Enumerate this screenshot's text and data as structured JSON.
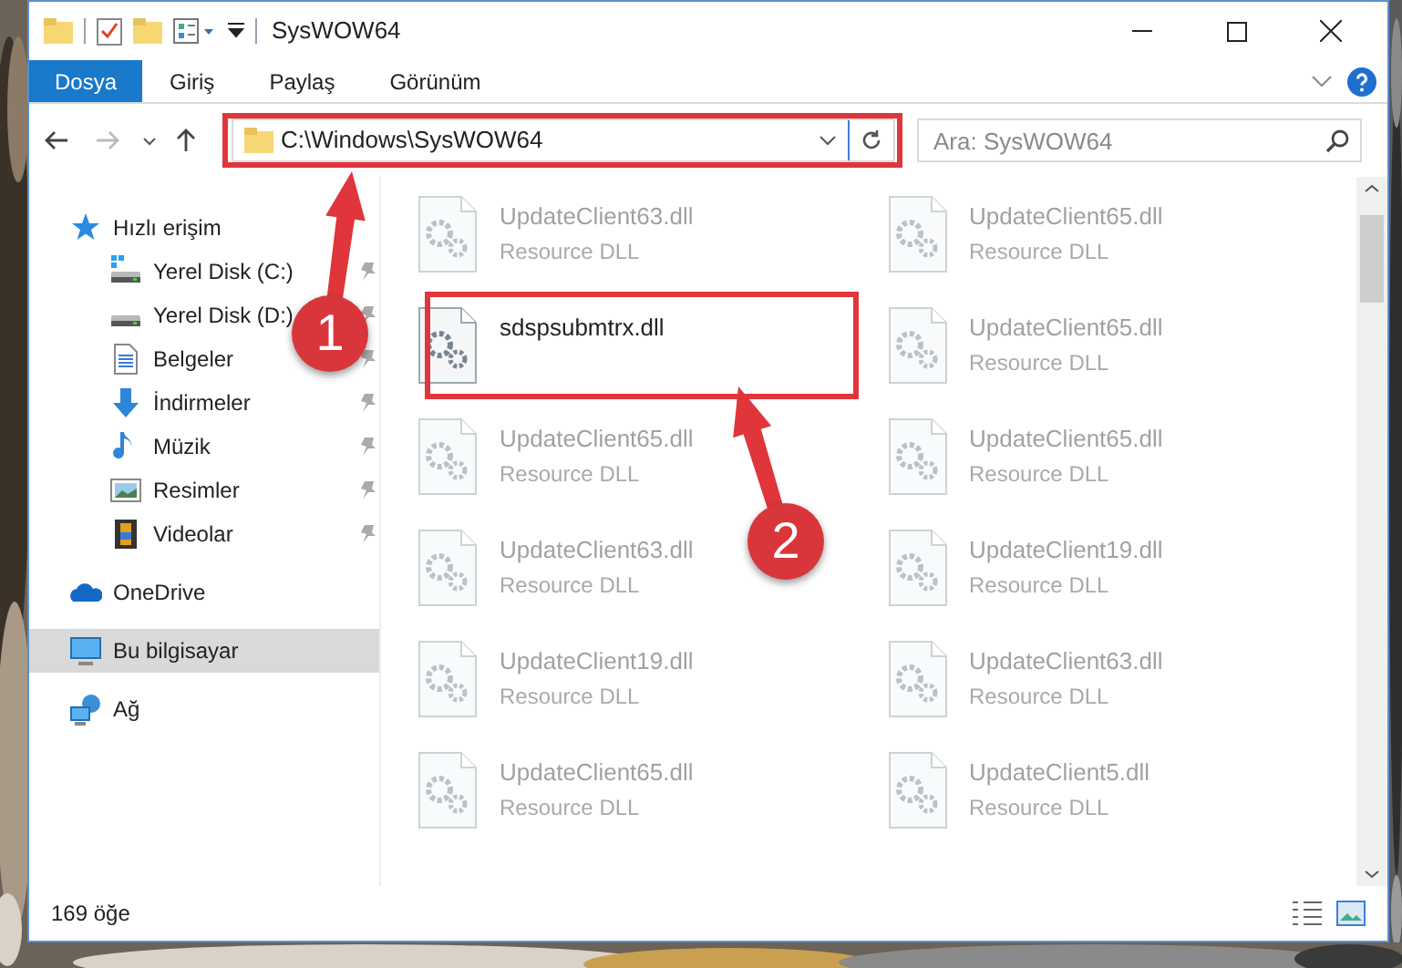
{
  "window": {
    "title": "SysWOW64"
  },
  "ribbon_tabs": [
    {
      "label": "Dosya",
      "selected": true
    },
    {
      "label": "Giriş",
      "selected": false
    },
    {
      "label": "Paylaş",
      "selected": false
    },
    {
      "label": "Görünüm",
      "selected": false
    }
  ],
  "address_bar": {
    "path": "C:\\Windows\\SysWOW64"
  },
  "search": {
    "placeholder": "Ara: SysWOW64"
  },
  "sidebar": {
    "items": [
      {
        "kind": "star",
        "label": "Hızlı erişim",
        "selected": false,
        "children": [
          {
            "kind": "disk-c",
            "label": "Yerel Disk (C:)",
            "pinned": true,
            "selected": false
          },
          {
            "kind": "disk",
            "label": "Yerel Disk (D:)",
            "pinned": true,
            "selected": false
          },
          {
            "kind": "document",
            "label": "Belgeler",
            "pinned": true,
            "selected": false
          },
          {
            "kind": "download",
            "label": "İndirmeler",
            "pinned": true,
            "selected": false
          },
          {
            "kind": "music",
            "label": "Müzik",
            "pinned": true,
            "selected": false
          },
          {
            "label": "Resimler",
            "pinned": true,
            "selected": false
          },
          {
            "kind": "video",
            "label": "Videolar",
            "pinned": true,
            "selected": false
          }
        ]
      },
      {
        "kind": "cloud",
        "label": "OneDrive",
        "selected": false
      },
      {
        "kind": "computer",
        "label": "Bu bilgisayar",
        "selected": true
      },
      {
        "kind": "network",
        "label": "Ağ",
        "selected": false
      }
    ]
  },
  "files": [
    {
      "name": "UpdateClient63.dll",
      "subtitle": "Resource DLL",
      "highlighted": false
    },
    {
      "name": "UpdateClient65.dll",
      "subtitle": "Resource DLL",
      "highlighted": false
    },
    {
      "name": "sdspsubmtrx.dll",
      "highlighted": true
    },
    {
      "name": "UpdateClient65.dll",
      "subtitle": "Resource DLL",
      "highlighted": false
    },
    {
      "name": "UpdateClient65.dll",
      "subtitle": "Resource DLL",
      "highlighted": false
    },
    {
      "name": "UpdateClient65.dll",
      "subtitle": "Resource DLL",
      "highlighted": false
    },
    {
      "name": "UpdateClient63.dll",
      "subtitle": "Resource DLL",
      "highlighted": false
    },
    {
      "name": "UpdateClient19.dll",
      "subtitle": "Resource DLL",
      "highlighted": false
    },
    {
      "name": "UpdateClient19.dll",
      "subtitle": "Resource DLL",
      "highlighted": false
    },
    {
      "name": "UpdateClient63.dll",
      "subtitle": "Resource DLL",
      "highlighted": false
    },
    {
      "name": "UpdateClient65.dll",
      "subtitle": "Resource DLL",
      "highlighted": false
    },
    {
      "name": "UpdateClient5.dll",
      "subtitle": "Resource DLL",
      "highlighted": false
    }
  ],
  "status_bar": {
    "count": "169 öğe"
  },
  "annotations": [
    {
      "label": "1"
    },
    {
      "label": "2"
    }
  ]
}
